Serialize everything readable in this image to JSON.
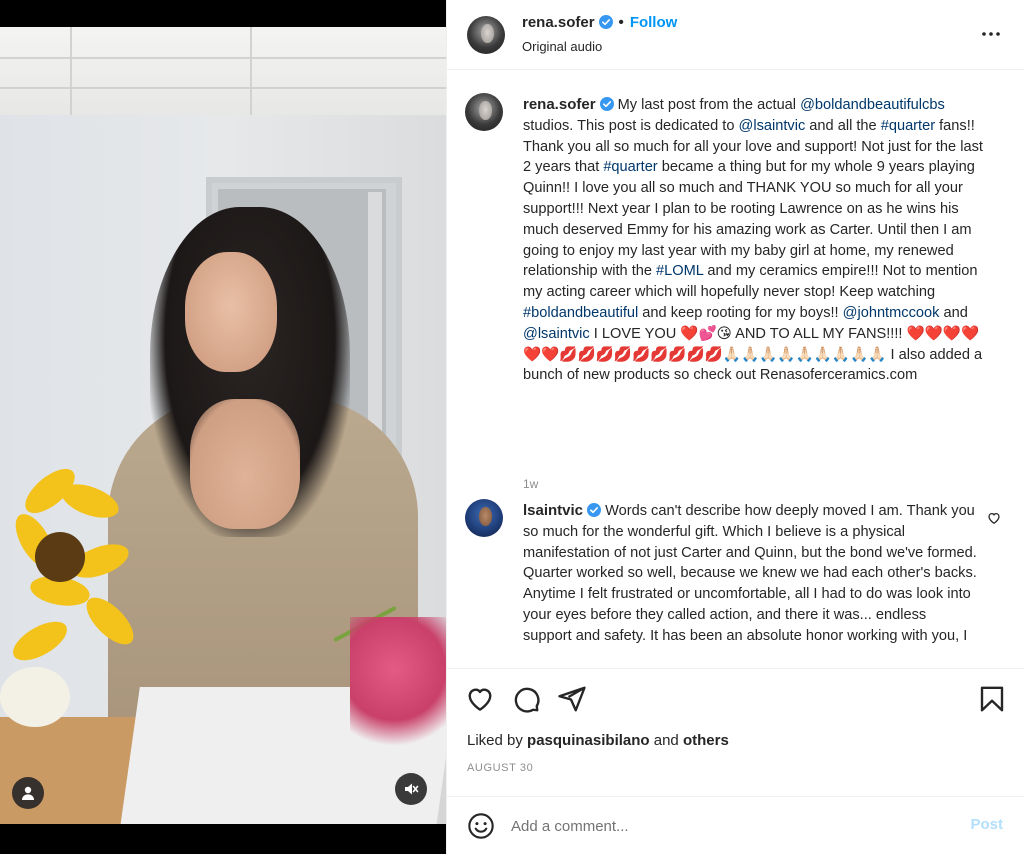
{
  "header": {
    "username": "rena.sofer",
    "dot": "•",
    "follow_label": "Follow",
    "audio": "Original audio"
  },
  "caption": {
    "username": "rena.sofer",
    "p1": " My last post from the actual ",
    "mention1": "@boldandbeautifulcbs",
    "p2": " studios. This post is dedicated to ",
    "mention2": "@lsaintvic",
    "p3": " and all the ",
    "tag1": "#quarter",
    "p4": " fans!! Thank you all so much for all your love and support! Not just for the last 2 years that ",
    "tag2": "#quarter",
    "p5": " became a thing but for my whole 9 years playing Quinn!! I love you all so much and THANK YOU so much for all your support!!! Next year I plan to be rooting Lawrence on as he wins his much deserved Emmy for his amazing work as Carter. Until then I am going to enjoy my last year with my baby girl at home, my renewed relationship with the ",
    "tag3": "#LOML",
    "p6": " and my ceramics empire!!! Not to mention my acting career which will hopefully never stop! Keep watching ",
    "tag4": "#boldandbeautiful",
    "p7": " and keep rooting for my boys!! ",
    "mention3": "@johntmccook",
    "p8": " and ",
    "mention4": "@lsaintvic",
    "p9": " I LOVE YOU ",
    "emoji1": "❤️💕😘",
    "p10": " AND TO ALL MY FANS!!!! ",
    "emoji2": "❤️❤️❤️❤️❤️❤️💋💋💋💋💋💋💋💋💋🙏🏻🙏🏻🙏🏻🙏🏻🙏🏻🙏🏻🙏🏻🙏🏻🙏🏻",
    "p11": " I also added a bunch of new products so check out Renasoferceramics.com",
    "time": "1w"
  },
  "reply": {
    "username": "lsaintvic",
    "text": " Words can't describe how deeply moved I am. Thank you so much for the wonderful gift. Which I believe is a physical manifestation of not just Carter and Quinn, but the bond we've formed. Quarter worked so well, because we knew we had each other's backs. Anytime I felt frustrated or uncomfortable, all I had to do was look into your eyes before they called action, and there it was... endless support and safety. It has been an absolute honor working with you, I"
  },
  "actions": {
    "liked_prefix": "Liked by ",
    "liked_user": "pasquinasibilano",
    "liked_and": " and ",
    "liked_others": "others",
    "date": "AUGUST 30"
  },
  "composer": {
    "placeholder": "Add a comment...",
    "post_label": "Post"
  },
  "colors": {
    "accent": "#0095f6",
    "link": "#00376b",
    "verified": "#3897f0",
    "post_disabled": "#b2dffc"
  },
  "icons": [
    "user-icon",
    "mute-icon",
    "more-icon",
    "heart-icon",
    "comment-icon",
    "share-icon",
    "bookmark-icon",
    "emoji-icon",
    "verified-icon"
  ]
}
